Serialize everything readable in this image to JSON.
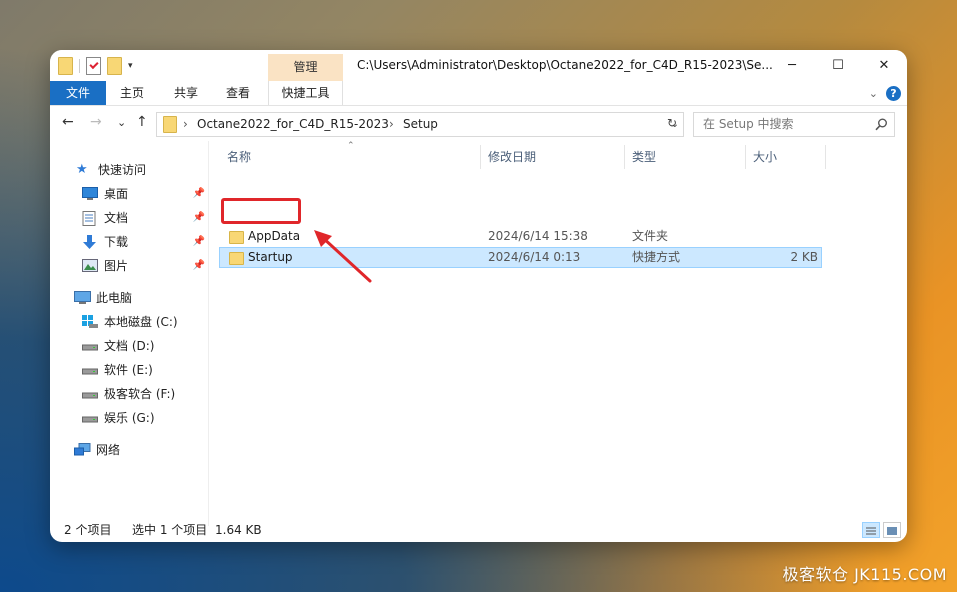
{
  "window": {
    "title_path": "C:\\Users\\Administrator\\Desktop\\Octane2022_for_C4D_R15-2023\\Se...",
    "context_tab_group": "管理",
    "controls": {
      "minimize": "─",
      "maximize": "☐",
      "close": "✕"
    }
  },
  "ribbon": {
    "tabs": [
      "文件",
      "主页",
      "共享",
      "查看",
      "快捷工具"
    ],
    "expand_icon": "chevron-down-icon",
    "help_label": "?"
  },
  "navigation": {
    "back": "←",
    "forward": "→",
    "recent": "⌄",
    "up": "↑",
    "breadcrumb": [
      "Octane2022_for_C4D_R15-2023",
      "Setup"
    ],
    "breadcrumb_sep": "›",
    "dropdown": "⌄",
    "refresh": "↻",
    "search_placeholder": "在 Setup 中搜索"
  },
  "sidebar": {
    "quick_access": "快速访问",
    "quick_items": [
      {
        "label": "桌面",
        "icon": "desktop-icon",
        "pinned": true
      },
      {
        "label": "文档",
        "icon": "documents-icon",
        "pinned": true
      },
      {
        "label": "下载",
        "icon": "download-icon",
        "pinned": true
      },
      {
        "label": "图片",
        "icon": "pictures-icon",
        "pinned": true
      }
    ],
    "this_pc": "此电脑",
    "drives": [
      {
        "label": "本地磁盘 (C:)",
        "icon": "windows-drive-icon"
      },
      {
        "label": "文档 (D:)",
        "icon": "drive-icon"
      },
      {
        "label": "软件 (E:)",
        "icon": "drive-icon"
      },
      {
        "label": "极客软合 (F:)",
        "icon": "drive-icon"
      },
      {
        "label": "娱乐 (G:)",
        "icon": "drive-icon"
      }
    ],
    "network": "网络"
  },
  "file_list": {
    "columns": [
      "名称",
      "修改日期",
      "类型",
      "大小"
    ],
    "rows": [
      {
        "name": "AppData",
        "date": "2024/6/14 15:38",
        "type": "文件夹",
        "size": "",
        "selected": false
      },
      {
        "name": "Startup",
        "date": "2024/6/14 0:13",
        "type": "快捷方式",
        "size": "2 KB",
        "selected": true
      }
    ]
  },
  "status": {
    "item_count": "2 个项目",
    "selected": "选中 1 个项目",
    "size": "1.64 KB"
  },
  "watermark": "极客软仓 JK115.COM",
  "colors": {
    "accent": "#1a6fc4",
    "selection": "#cce8ff",
    "highlight_box": "#e0262a",
    "context_tab": "#fae3c4"
  }
}
